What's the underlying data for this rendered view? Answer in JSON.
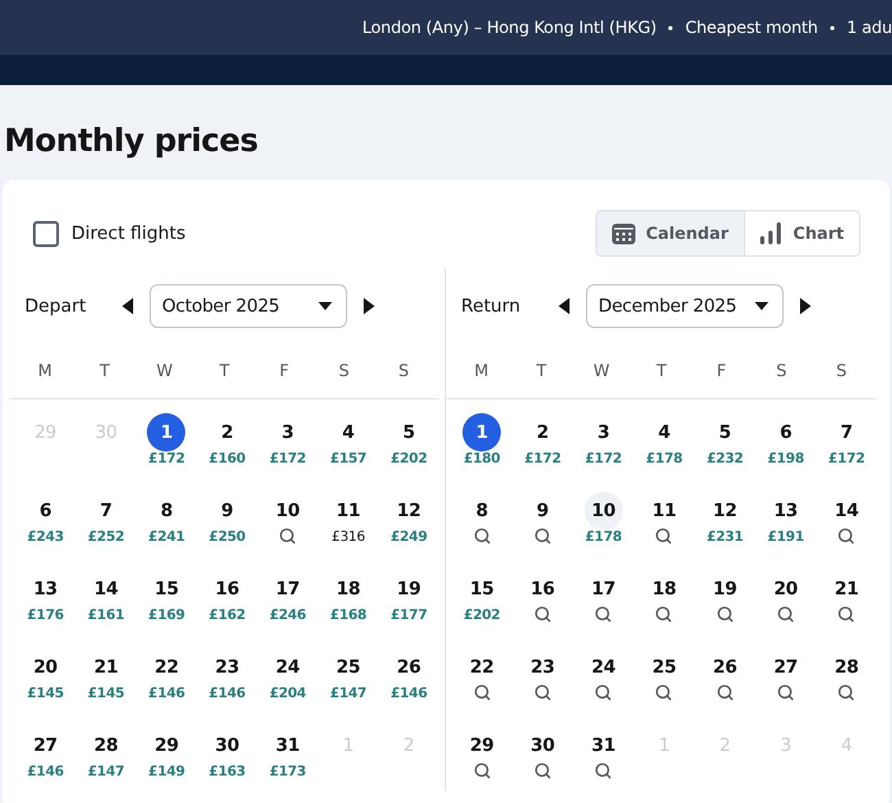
{
  "header": {
    "summary": [
      "London (Any) – Hong Kong Intl (HKG)",
      "Cheapest month",
      "1 adu"
    ]
  },
  "title": "Monthly prices",
  "filters": {
    "direct_flights": {
      "label": "Direct flights",
      "checked": false
    }
  },
  "view_tabs": [
    {
      "label": "Calendar",
      "kind": "calendar",
      "selected": true
    },
    {
      "label": "Chart",
      "kind": "chart",
      "selected": false
    }
  ],
  "panels": [
    {
      "label": "Depart",
      "month": "October 2025",
      "weekdays": [
        "M",
        "T",
        "W",
        "T",
        "F",
        "S",
        "S"
      ],
      "days": [
        {
          "day": "29",
          "kind": "empty",
          "outside": true,
          "selected": false,
          "hovered": false
        },
        {
          "day": "30",
          "kind": "empty",
          "outside": true,
          "selected": false,
          "hovered": false
        },
        {
          "day": "1",
          "kind": "price",
          "price": "£172",
          "outside": false,
          "selected": true,
          "hovered": false
        },
        {
          "day": "2",
          "kind": "price",
          "price": "£160",
          "outside": false,
          "selected": false,
          "hovered": false
        },
        {
          "day": "3",
          "kind": "price",
          "price": "£172",
          "outside": false,
          "selected": false,
          "hovered": false
        },
        {
          "day": "4",
          "kind": "price",
          "price": "£157",
          "outside": false,
          "selected": false,
          "hovered": false
        },
        {
          "day": "5",
          "kind": "price",
          "price": "£202",
          "outside": false,
          "selected": false,
          "hovered": false
        },
        {
          "day": "6",
          "kind": "price",
          "price": "£243",
          "outside": false,
          "selected": false,
          "hovered": false
        },
        {
          "day": "7",
          "kind": "price",
          "price": "£252",
          "outside": false,
          "selected": false,
          "hovered": false
        },
        {
          "day": "8",
          "kind": "price",
          "price": "£241",
          "outside": false,
          "selected": false,
          "hovered": false
        },
        {
          "day": "9",
          "kind": "price",
          "price": "£250",
          "outside": false,
          "selected": false,
          "hovered": false
        },
        {
          "day": "10",
          "kind": "search",
          "outside": false,
          "selected": false,
          "hovered": false
        },
        {
          "day": "11",
          "kind": "plain_price",
          "price": "£316",
          "outside": false,
          "selected": false,
          "hovered": false
        },
        {
          "day": "12",
          "kind": "price",
          "price": "£249",
          "outside": false,
          "selected": false,
          "hovered": false
        },
        {
          "day": "13",
          "kind": "price",
          "price": "£176",
          "outside": false,
          "selected": false,
          "hovered": false
        },
        {
          "day": "14",
          "kind": "price",
          "price": "£161",
          "outside": false,
          "selected": false,
          "hovered": false
        },
        {
          "day": "15",
          "kind": "price",
          "price": "£169",
          "outside": false,
          "selected": false,
          "hovered": false
        },
        {
          "day": "16",
          "kind": "price",
          "price": "£162",
          "outside": false,
          "selected": false,
          "hovered": false
        },
        {
          "day": "17",
          "kind": "price",
          "price": "£246",
          "outside": false,
          "selected": false,
          "hovered": false
        },
        {
          "day": "18",
          "kind": "price",
          "price": "£168",
          "outside": false,
          "selected": false,
          "hovered": false
        },
        {
          "day": "19",
          "kind": "price",
          "price": "£177",
          "outside": false,
          "selected": false,
          "hovered": false
        },
        {
          "day": "20",
          "kind": "price",
          "price": "£145",
          "outside": false,
          "selected": false,
          "hovered": false
        },
        {
          "day": "21",
          "kind": "price",
          "price": "£145",
          "outside": false,
          "selected": false,
          "hovered": false
        },
        {
          "day": "22",
          "kind": "price",
          "price": "£146",
          "outside": false,
          "selected": false,
          "hovered": false
        },
        {
          "day": "23",
          "kind": "price",
          "price": "£146",
          "outside": false,
          "selected": false,
          "hovered": false
        },
        {
          "day": "24",
          "kind": "price",
          "price": "£204",
          "outside": false,
          "selected": false,
          "hovered": false
        },
        {
          "day": "25",
          "kind": "price",
          "price": "£147",
          "outside": false,
          "selected": false,
          "hovered": false
        },
        {
          "day": "26",
          "kind": "price",
          "price": "£146",
          "outside": false,
          "selected": false,
          "hovered": false
        },
        {
          "day": "27",
          "kind": "price",
          "price": "£146",
          "outside": false,
          "selected": false,
          "hovered": false
        },
        {
          "day": "28",
          "kind": "price",
          "price": "£147",
          "outside": false,
          "selected": false,
          "hovered": false
        },
        {
          "day": "29",
          "kind": "price",
          "price": "£149",
          "outside": false,
          "selected": false,
          "hovered": false
        },
        {
          "day": "30",
          "kind": "price",
          "price": "£163",
          "outside": false,
          "selected": false,
          "hovered": false
        },
        {
          "day": "31",
          "kind": "price",
          "price": "£173",
          "outside": false,
          "selected": false,
          "hovered": false
        },
        {
          "day": "1",
          "kind": "empty",
          "outside": true,
          "selected": false,
          "hovered": false
        },
        {
          "day": "2",
          "kind": "empty",
          "outside": true,
          "selected": false,
          "hovered": false
        }
      ]
    },
    {
      "label": "Return",
      "month": "December 2025",
      "weekdays": [
        "M",
        "T",
        "W",
        "T",
        "F",
        "S",
        "S"
      ],
      "days": [
        {
          "day": "1",
          "kind": "price",
          "price": "£180",
          "outside": false,
          "selected": true,
          "hovered": false
        },
        {
          "day": "2",
          "kind": "price",
          "price": "£172",
          "outside": false,
          "selected": false,
          "hovered": false
        },
        {
          "day": "3",
          "kind": "price",
          "price": "£172",
          "outside": false,
          "selected": false,
          "hovered": false
        },
        {
          "day": "4",
          "kind": "price",
          "price": "£178",
          "outside": false,
          "selected": false,
          "hovered": false
        },
        {
          "day": "5",
          "kind": "price",
          "price": "£232",
          "outside": false,
          "selected": false,
          "hovered": false
        },
        {
          "day": "6",
          "kind": "price",
          "price": "£198",
          "outside": false,
          "selected": false,
          "hovered": false
        },
        {
          "day": "7",
          "kind": "price",
          "price": "£172",
          "outside": false,
          "selected": false,
          "hovered": false
        },
        {
          "day": "8",
          "kind": "search",
          "outside": false,
          "selected": false,
          "hovered": false
        },
        {
          "day": "9",
          "kind": "search",
          "outside": false,
          "selected": false,
          "hovered": false
        },
        {
          "day": "10",
          "kind": "price",
          "price": "£178",
          "outside": false,
          "selected": false,
          "hovered": true
        },
        {
          "day": "11",
          "kind": "search",
          "outside": false,
          "selected": false,
          "hovered": false
        },
        {
          "day": "12",
          "kind": "price",
          "price": "£231",
          "outside": false,
          "selected": false,
          "hovered": false
        },
        {
          "day": "13",
          "kind": "price",
          "price": "£191",
          "outside": false,
          "selected": false,
          "hovered": false
        },
        {
          "day": "14",
          "kind": "search",
          "outside": false,
          "selected": false,
          "hovered": false
        },
        {
          "day": "15",
          "kind": "price",
          "price": "£202",
          "outside": false,
          "selected": false,
          "hovered": false
        },
        {
          "day": "16",
          "kind": "search",
          "outside": false,
          "selected": false,
          "hovered": false
        },
        {
          "day": "17",
          "kind": "search",
          "outside": false,
          "selected": false,
          "hovered": false
        },
        {
          "day": "18",
          "kind": "search",
          "outside": false,
          "selected": false,
          "hovered": false
        },
        {
          "day": "19",
          "kind": "search",
          "outside": false,
          "selected": false,
          "hovered": false
        },
        {
          "day": "20",
          "kind": "search",
          "outside": false,
          "selected": false,
          "hovered": false
        },
        {
          "day": "21",
          "kind": "search",
          "outside": false,
          "selected": false,
          "hovered": false
        },
        {
          "day": "22",
          "kind": "search",
          "outside": false,
          "selected": false,
          "hovered": false
        },
        {
          "day": "23",
          "kind": "search",
          "outside": false,
          "selected": false,
          "hovered": false
        },
        {
          "day": "24",
          "kind": "search",
          "outside": false,
          "selected": false,
          "hovered": false
        },
        {
          "day": "25",
          "kind": "search",
          "outside": false,
          "selected": false,
          "hovered": false
        },
        {
          "day": "26",
          "kind": "search",
          "outside": false,
          "selected": false,
          "hovered": false
        },
        {
          "day": "27",
          "kind": "search",
          "outside": false,
          "selected": false,
          "hovered": false
        },
        {
          "day": "28",
          "kind": "search",
          "outside": false,
          "selected": false,
          "hovered": false
        },
        {
          "day": "29",
          "kind": "search",
          "outside": false,
          "selected": false,
          "hovered": false
        },
        {
          "day": "30",
          "kind": "search",
          "outside": false,
          "selected": false,
          "hovered": false
        },
        {
          "day": "31",
          "kind": "search",
          "outside": false,
          "selected": false,
          "hovered": false
        },
        {
          "day": "1",
          "kind": "empty",
          "outside": true,
          "selected": false,
          "hovered": false
        },
        {
          "day": "2",
          "kind": "empty",
          "outside": true,
          "selected": false,
          "hovered": false
        },
        {
          "day": "3",
          "kind": "empty",
          "outside": true,
          "selected": false,
          "hovered": false
        },
        {
          "day": "4",
          "kind": "empty",
          "outside": true,
          "selected": false,
          "hovered": false
        }
      ]
    }
  ]
}
